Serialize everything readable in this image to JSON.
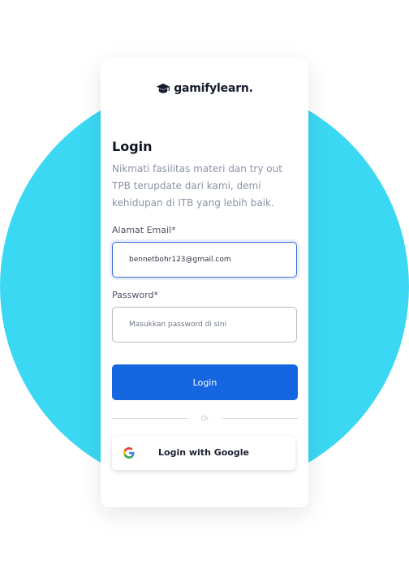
{
  "brand": {
    "name": "gamifylearn.",
    "logo_icon": "graduation-cap-icon"
  },
  "login": {
    "title": "Login",
    "subtitle": "Nikmati fasilitas materi dan try out TPB terupdate dari kami, demi kehidupan di ITB yang lebih baik.",
    "email_label": "Alamat Email*",
    "email_value": "bennetbohr123@gmail.com",
    "password_label": "Password*",
    "password_placeholder": "Masukkan password di sini",
    "login_button": "Login",
    "divider_text": "Or",
    "google_button": "Login with Google",
    "google_icon": "google-g-icon"
  },
  "colors": {
    "accent": "#1566e0",
    "background_circle": "#3bd8f3",
    "card": "#ffffff"
  }
}
